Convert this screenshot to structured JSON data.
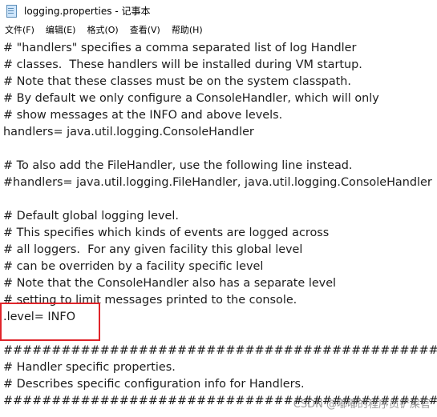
{
  "window": {
    "title": "logging.properties - 记事本"
  },
  "menu": [
    "文件(F)",
    "编辑(E)",
    "格式(O)",
    "查看(V)",
    "帮助(H)"
  ],
  "editor": {
    "lines": [
      "# \"handlers\" specifies a comma separated list of log Handler",
      "# classes.  These handlers will be installed during VM startup.",
      "# Note that these classes must be on the system classpath.",
      "# By default we only configure a ConsoleHandler, which will only",
      "# show messages at the INFO and above levels.",
      "handlers= java.util.logging.ConsoleHandler",
      "",
      "# To also add the FileHandler, use the following line instead.",
      "#handlers= java.util.logging.FileHandler, java.util.logging.ConsoleHandler",
      "",
      "# Default global logging level.",
      "# This specifies which kinds of events are logged across",
      "# all loggers.  For any given facility this global level",
      "# can be overriden by a facility specific level",
      "# Note that the ConsoleHandler also has a separate level",
      "# setting to limit messages printed to the console.",
      ".level= INFO",
      "",
      "############################################################",
      "# Handler specific properties.",
      "# Describes specific configuration info for Handlers.",
      "############################################################"
    ]
  },
  "highlight": {
    "color": "#e0242a"
  },
  "watermark": "CSDN @嘟嘟的程序员铲屎官"
}
